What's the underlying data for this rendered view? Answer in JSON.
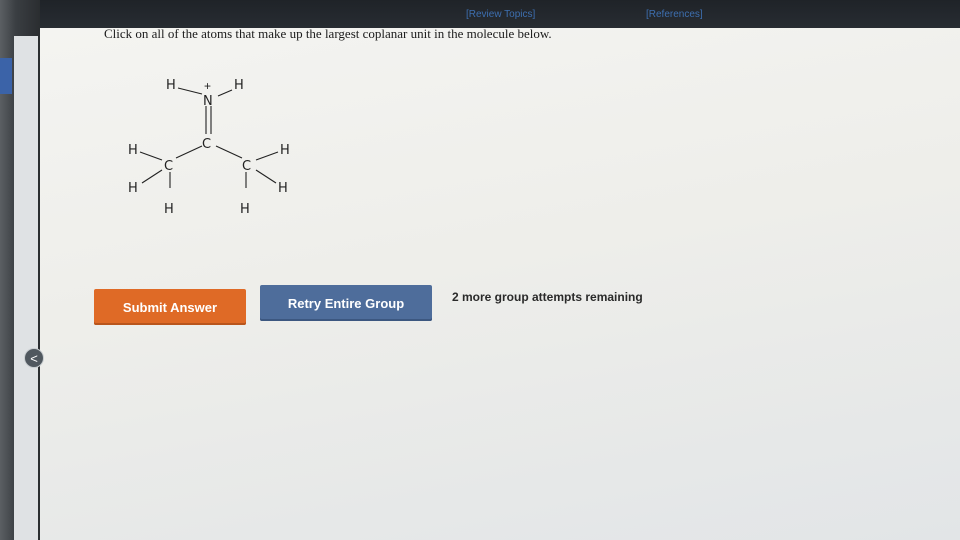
{
  "header": {
    "review_topics": "[Review Topics]",
    "references": "[References]"
  },
  "question": {
    "text": "Click on all of the atoms that make up the largest coplanar unit in the molecule below."
  },
  "molecule": {
    "atoms": {
      "h_top_left": "H",
      "plus": "+",
      "h_top_right": "H",
      "n": "N",
      "h_left_upper": "H",
      "c_center": "C",
      "h_right_upper": "H",
      "c_left": "C",
      "c_right": "C",
      "h_left_lower": "H",
      "h_right_lower": "H",
      "h_bottom_left": "H",
      "h_bottom_right": "H"
    }
  },
  "actions": {
    "submit_label": "Submit Answer",
    "retry_label": "Retry Entire Group",
    "attempts_text": "2 more group attempts remaining"
  },
  "sidebar": {
    "collapse_icon": "<"
  },
  "colors": {
    "submit": "#df6a26",
    "retry": "#4e6d9b"
  }
}
